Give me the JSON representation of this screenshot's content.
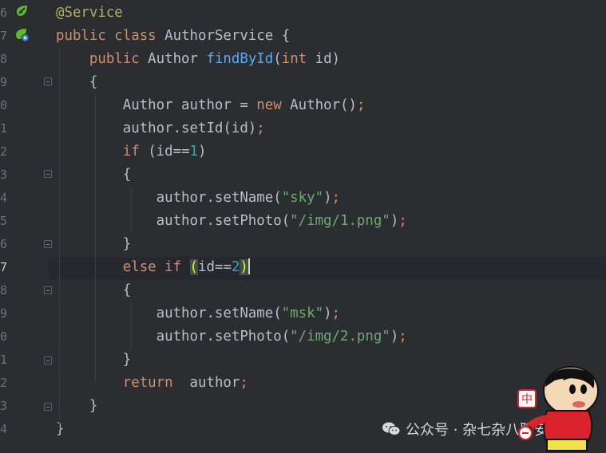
{
  "editor": {
    "lines": [
      {
        "num": "6",
        "tokens": [
          {
            "t": "@Service",
            "c": "ann"
          }
        ]
      },
      {
        "num": "7",
        "tokens": [
          {
            "t": "public ",
            "c": "kw"
          },
          {
            "t": "class ",
            "c": "kw"
          },
          {
            "t": "AuthorService {",
            "c": ""
          }
        ]
      },
      {
        "num": "8",
        "tokens": [
          {
            "t": "    public ",
            "c": "kw"
          },
          {
            "t": "Author ",
            "c": ""
          },
          {
            "t": "findById",
            "c": "decl"
          },
          {
            "t": "(",
            "c": ""
          },
          {
            "t": "int ",
            "c": "kw"
          },
          {
            "t": "id)",
            "c": ""
          }
        ]
      },
      {
        "num": "9",
        "tokens": [
          {
            "t": "    {",
            "c": ""
          }
        ]
      },
      {
        "num": "0",
        "tokens": [
          {
            "t": "        Author author = ",
            "c": ""
          },
          {
            "t": "new ",
            "c": "kw"
          },
          {
            "t": "Author()",
            "c": ""
          },
          {
            "t": ";",
            "c": "kw"
          }
        ]
      },
      {
        "num": "1",
        "tokens": [
          {
            "t": "        author.setId(id)",
            "c": ""
          },
          {
            "t": ";",
            "c": "kw"
          }
        ]
      },
      {
        "num": "2",
        "tokens": [
          {
            "t": "        ",
            "c": ""
          },
          {
            "t": "if ",
            "c": "kw"
          },
          {
            "t": "(id==",
            "c": ""
          },
          {
            "t": "1",
            "c": "num"
          },
          {
            "t": ")",
            "c": ""
          }
        ]
      },
      {
        "num": "3",
        "tokens": [
          {
            "t": "        {",
            "c": ""
          }
        ]
      },
      {
        "num": "4",
        "tokens": [
          {
            "t": "            author.setName(",
            "c": ""
          },
          {
            "t": "\"sky\"",
            "c": "str"
          },
          {
            "t": ")",
            "c": ""
          },
          {
            "t": ";",
            "c": "kw"
          }
        ]
      },
      {
        "num": "5",
        "tokens": [
          {
            "t": "            author.setPhoto(",
            "c": ""
          },
          {
            "t": "\"/img/1.png\"",
            "c": "str"
          },
          {
            "t": ")",
            "c": ""
          },
          {
            "t": ";",
            "c": "kw"
          }
        ]
      },
      {
        "num": "6",
        "tokens": [
          {
            "t": "        }",
            "c": ""
          }
        ]
      },
      {
        "num": "7",
        "tokens": [
          {
            "t": "        ",
            "c": ""
          },
          {
            "t": "else ",
            "c": "kw"
          },
          {
            "t": "if ",
            "c": "kw"
          },
          {
            "t": "(",
            "c": "paren-hl"
          },
          {
            "t": "id==",
            "c": ""
          },
          {
            "t": "2",
            "c": "num"
          },
          {
            "t": ")",
            "c": "paren-hl"
          }
        ],
        "current": true
      },
      {
        "num": "8",
        "tokens": [
          {
            "t": "        {",
            "c": ""
          }
        ]
      },
      {
        "num": "9",
        "tokens": [
          {
            "t": "            author.setName(",
            "c": ""
          },
          {
            "t": "\"msk\"",
            "c": "str"
          },
          {
            "t": ")",
            "c": ""
          },
          {
            "t": ";",
            "c": "kw"
          }
        ]
      },
      {
        "num": "0",
        "tokens": [
          {
            "t": "            author.setPhoto(",
            "c": ""
          },
          {
            "t": "\"/img/2.png\"",
            "c": "str"
          },
          {
            "t": ")",
            "c": ""
          },
          {
            "t": ";",
            "c": "kw"
          }
        ]
      },
      {
        "num": "1",
        "tokens": [
          {
            "t": "        }",
            "c": ""
          }
        ]
      },
      {
        "num": "2",
        "tokens": [
          {
            "t": "        ",
            "c": ""
          },
          {
            "t": "return  ",
            "c": "kw"
          },
          {
            "t": "author",
            "c": ""
          },
          {
            "t": ";",
            "c": "kw"
          }
        ]
      },
      {
        "num": "3",
        "tokens": [
          {
            "t": "    }",
            "c": ""
          }
        ]
      },
      {
        "num": "4",
        "tokens": [
          {
            "t": "}",
            "c": ""
          }
        ]
      }
    ],
    "gutter_icons": [
      {
        "line": "6",
        "icon": "spring-bean-icon",
        "color": "#5fb832"
      },
      {
        "line": "7",
        "icon": "spring-class-icon",
        "color": "#5fb832"
      }
    ],
    "colors": {
      "background": "#2b2d30",
      "keyword": "#cf8e6d",
      "annotation": "#b3ae60",
      "method_declaration": "#57aaf7",
      "string": "#6aab73",
      "number": "#2aacb8",
      "text": "#bcbec4",
      "matched_paren": "#ffef28"
    }
  },
  "watermark": {
    "text": "公众号 · 杂七杂八聊安全",
    "icon": "wechat-icon"
  },
  "mascot": {
    "icon": "cartoon-boy-mascot"
  }
}
